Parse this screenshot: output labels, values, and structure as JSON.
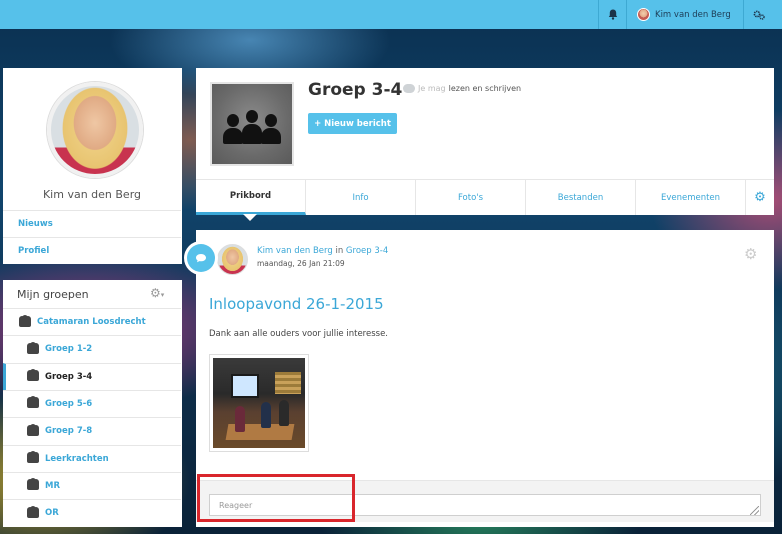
{
  "topbar": {
    "bell_icon": "bell-icon",
    "user_name": "Kim van den Berg",
    "settings_icon": "gears-icon"
  },
  "profile": {
    "name": "Kim van den Berg",
    "links": [
      "Nieuws",
      "Profiel"
    ]
  },
  "groups": {
    "heading": "Mijn groepen",
    "items": [
      {
        "label": "Catamaran Loosdrecht",
        "level": 0,
        "active": false
      },
      {
        "label": "Groep 1-2",
        "level": 1,
        "active": false
      },
      {
        "label": "Groep 3-4",
        "level": 1,
        "active": true
      },
      {
        "label": "Groep 5-6",
        "level": 1,
        "active": false
      },
      {
        "label": "Groep 7-8",
        "level": 1,
        "active": false
      },
      {
        "label": "Leerkrachten",
        "level": 1,
        "active": false
      },
      {
        "label": "MR",
        "level": 1,
        "active": false
      },
      {
        "label": "OR",
        "level": 1,
        "active": false
      }
    ]
  },
  "group_header": {
    "title": "Groep 3-4",
    "permission_muted": "Je mag",
    "permission": "lezen en schrijven",
    "new_post_label": "+ Nieuw bericht",
    "tabs": [
      {
        "label": "Prikbord",
        "active": true
      },
      {
        "label": "Info",
        "active": false
      },
      {
        "label": "Foto's",
        "active": false
      },
      {
        "label": "Bestanden",
        "active": false
      },
      {
        "label": "Evenementen",
        "active": false
      }
    ]
  },
  "post": {
    "author": "Kim van den Berg",
    "in_text": "in",
    "group": "Groep 3-4",
    "date": "maandag, 26 Jan 21:09",
    "title": "Inloopavond 26-1-2015",
    "body": "Dank aan alle ouders voor jullie interesse.",
    "comment_placeholder": "Reageer"
  },
  "colors": {
    "accent": "#56c1ea",
    "link": "#3ba7d7",
    "highlight": "#d9262c"
  }
}
